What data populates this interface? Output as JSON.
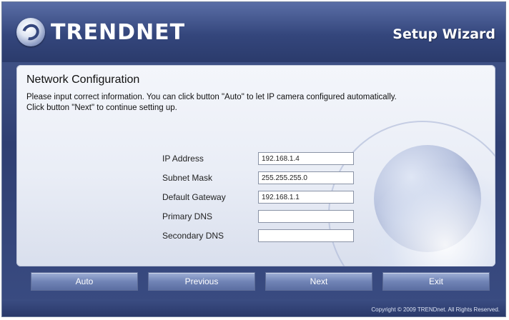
{
  "app": {
    "logo_text": "TRENDNET",
    "wizard_title": "Setup Wizard"
  },
  "panel": {
    "title": "Network Configuration",
    "instruction_1": "Please input correct information. You can click button \"Auto\" to let IP camera configured automatically.",
    "instruction_2": "Click button \"Next\" to continue setting up."
  },
  "form": {
    "fields": [
      {
        "label": "IP Address",
        "value": "192.168.1.4"
      },
      {
        "label": "Subnet Mask",
        "value": "255.255.255.0"
      },
      {
        "label": "Default Gateway",
        "value": "192.168.1.1"
      },
      {
        "label": "Primary DNS",
        "value": ""
      },
      {
        "label": "Secondary DNS",
        "value": ""
      }
    ]
  },
  "buttons": {
    "auto": "Auto",
    "previous": "Previous",
    "next": "Next",
    "exit": "Exit"
  },
  "footer": {
    "copyright": "Copyright © 2009 TRENDnet. All Rights Reserved."
  },
  "colors": {
    "header_bg": "#34467c",
    "panel_bg": "#eef1f8",
    "button_bg": "#7184b6"
  },
  "icons": {
    "logo": "trendnet-logo-icon"
  }
}
